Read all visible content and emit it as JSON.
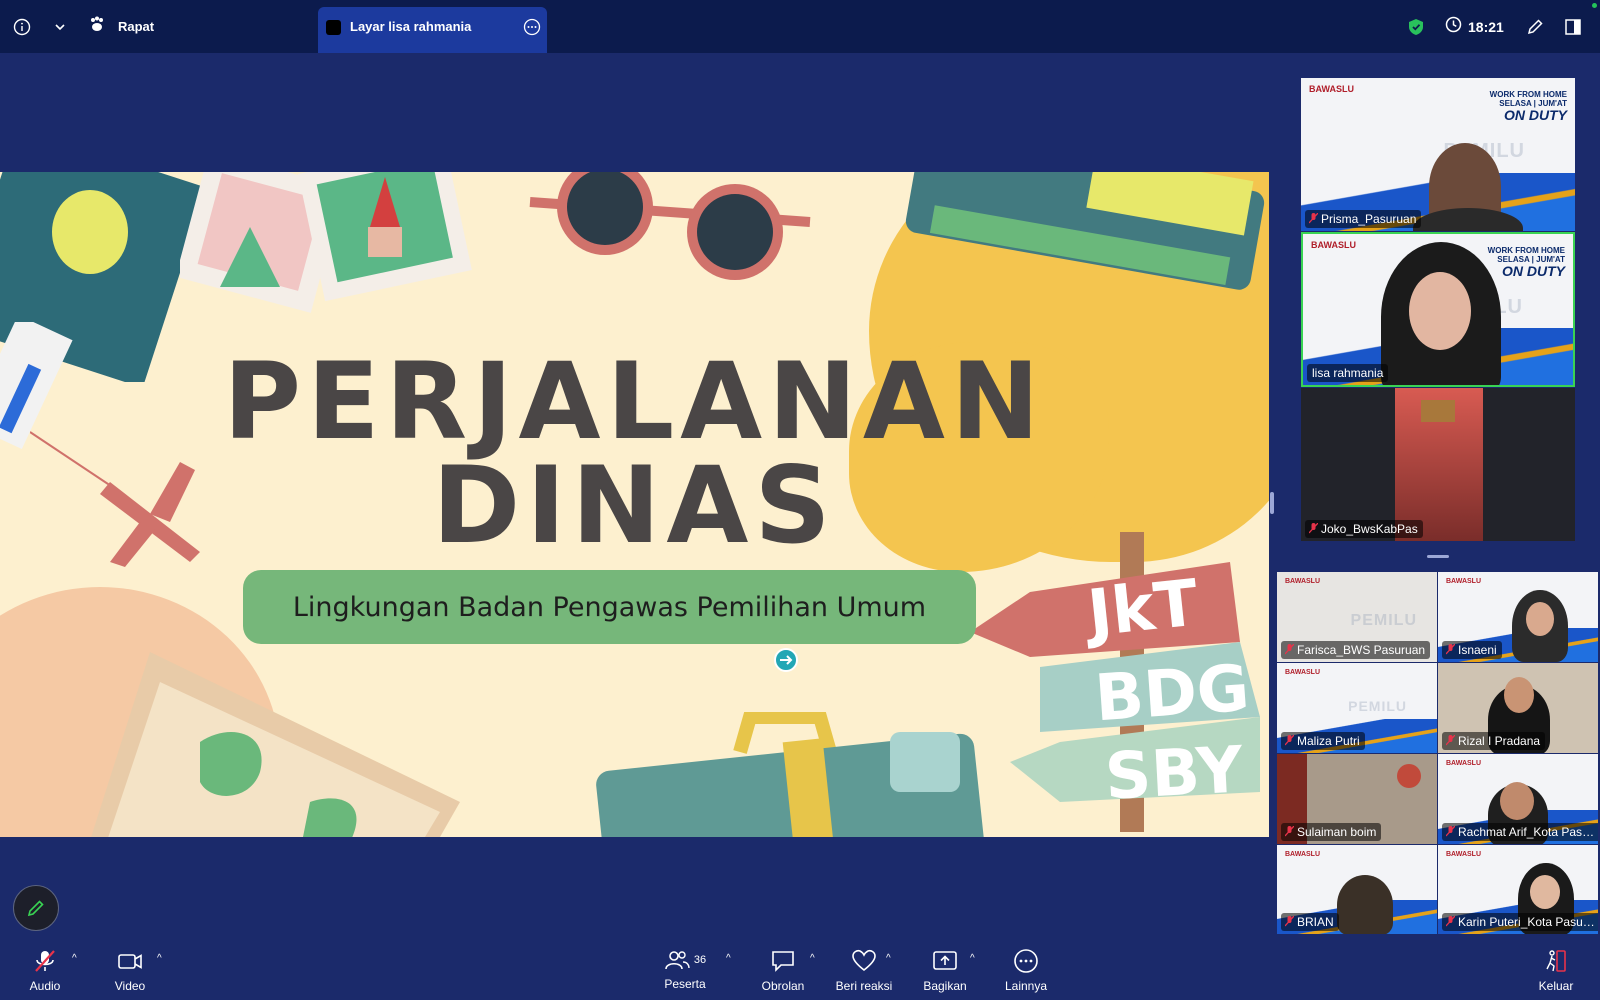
{
  "topbar": {
    "meeting_label": "Rapat",
    "share_tab_label": "Layar lisa rahmania",
    "clock": "18:21"
  },
  "slide": {
    "title_line1": "PERJALANAN",
    "title_line2": "DINAS",
    "subtitle": "Lingkungan Badan Pengawas Pemilihan Umum",
    "signs": [
      "JkT",
      "BDG",
      "SBY"
    ]
  },
  "tile_branding": {
    "brand": "BAWASLU",
    "wfh_line1": "WORK FROM HOME",
    "wfh_line2": "SELASA | JUM'AT",
    "wfh_line3": "ON DUTY",
    "watermark": "PEMILU"
  },
  "participants_large": [
    {
      "name": "Prisma_Pasuruan"
    },
    {
      "name": "lisa rahmania"
    },
    {
      "name": "Joko_BwsKabPas"
    }
  ],
  "participants_grid": [
    {
      "name": "Farisca_BWS Pasuruan"
    },
    {
      "name": "Isnaeni"
    },
    {
      "name": "Maliza Putri"
    },
    {
      "name": "Rizal I Pradana"
    },
    {
      "name": "Sulaiman boim"
    },
    {
      "name": "Rachmat Arif_Kota Pasu..."
    },
    {
      "name": "BRIAN"
    },
    {
      "name": "Karin Puteri_Kota Pasur..."
    }
  ],
  "toolbar": {
    "audio": "Audio",
    "video": "Video",
    "participants": "Peserta",
    "participants_count": "36",
    "chat": "Obrolan",
    "reactions": "Beri reaksi",
    "share": "Bagikan",
    "more": "Lainnya",
    "leave": "Keluar"
  },
  "colors": {
    "background": "#1b2a6b",
    "topbar": "#0c1b4d",
    "share_tab": "#1c3a9e",
    "active_speaker": "#39d353",
    "leave": "#e8334a",
    "pill": "#76b77a"
  }
}
